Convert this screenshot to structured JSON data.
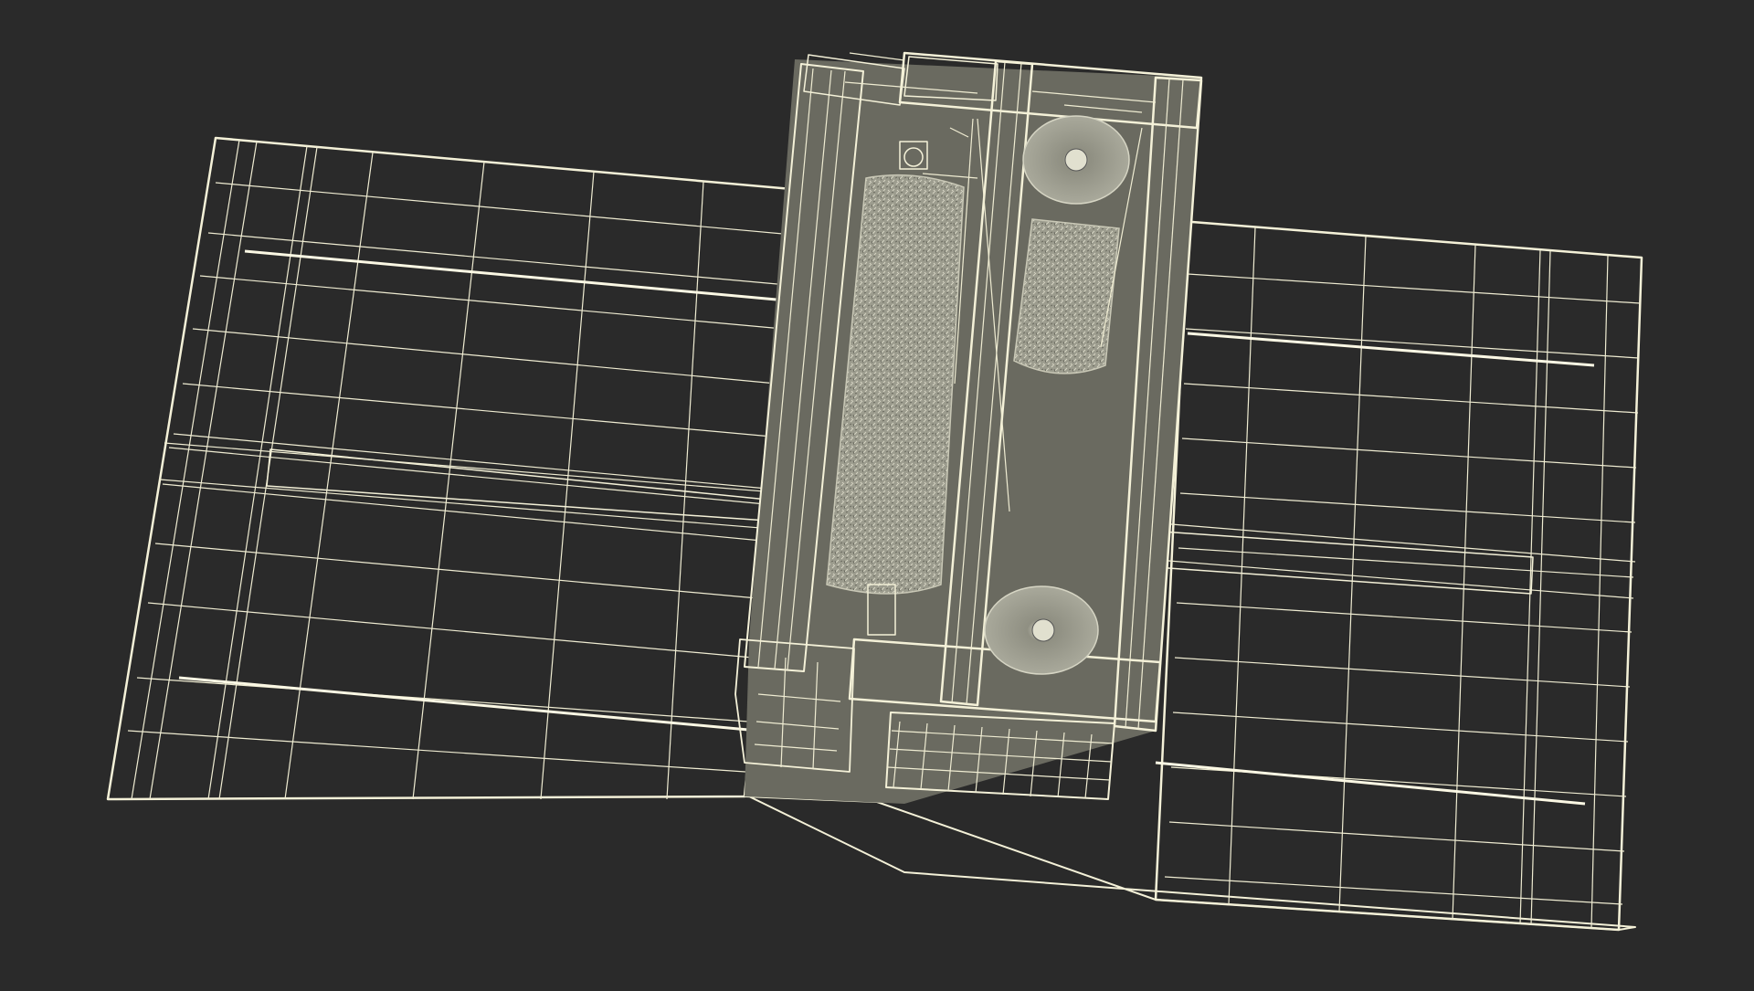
{
  "scene": {
    "subject": "car-wash-machine-wireframe",
    "colors": {
      "background": "#2a2a2a",
      "floor": "#737367",
      "wire": "#f4f1d8",
      "brush": "#a3a394",
      "grate": "#4f4f47"
    }
  }
}
